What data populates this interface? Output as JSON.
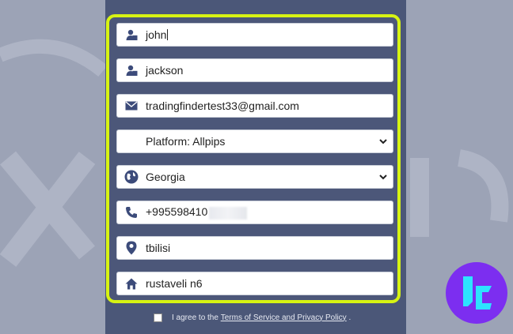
{
  "form": {
    "first_name": "john",
    "last_name": "jackson",
    "email": "tradingfindertest33@gmail.com",
    "platform": "Platform: Allpips",
    "country": "Georgia",
    "phone": "+995598410",
    "city": "tbilisi",
    "address": "rustaveli n6"
  },
  "agreement": {
    "text_before": "I agree to the",
    "link": "Terms of Service and Privacy Policy",
    "text_after": "."
  },
  "colors": {
    "highlight": "#d7f313",
    "icon": "#3c4b7a",
    "badge": "#7c2ef0",
    "badge_glyph": "#2de3ff"
  },
  "icons": [
    "user-icon",
    "user-icon",
    "envelope-icon",
    "chevron-down-icon",
    "globe-icon",
    "phone-icon",
    "location-pin-icon",
    "home-icon",
    "tf-logo"
  ]
}
